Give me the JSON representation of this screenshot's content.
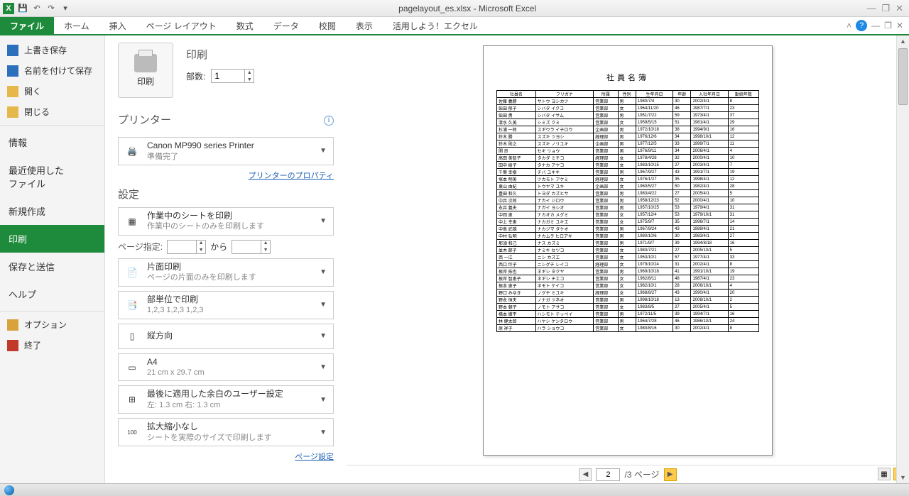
{
  "titlebar": {
    "title": "pagelayout_es.xlsx - Microsoft Excel"
  },
  "ribbon": {
    "file": "ファイル",
    "tabs": [
      "ホーム",
      "挿入",
      "ページ レイアウト",
      "数式",
      "データ",
      "校閲",
      "表示",
      "活用しよう！エクセル"
    ]
  },
  "nav": {
    "save": "上書き保存",
    "saveas": "名前を付けて保存",
    "open": "開く",
    "close": "閉じる",
    "info": "情報",
    "recent1": "最近使用した",
    "recent2": "ファイル",
    "new": "新規作成",
    "print": "印刷",
    "share": "保存と送信",
    "help": "ヘルプ",
    "options": "オプション",
    "exit": "終了"
  },
  "print": {
    "heading": "印刷",
    "button": "印刷",
    "copies_label": "部数:",
    "copies_value": "1"
  },
  "printer": {
    "heading": "プリンター",
    "name": "Canon MP990 series Printer",
    "status": "準備完了",
    "props_link": "プリンターのプロパティ"
  },
  "settings": {
    "heading": "設定",
    "sheet_main": "作業中のシートを印刷",
    "sheet_sub": "作業中のシートのみを印刷します",
    "pages_label": "ページ指定:",
    "pages_sep": "から",
    "duplex_main": "片面印刷",
    "duplex_sub": "ページの片面のみを印刷します",
    "collate_main": "部単位で印刷",
    "collate_sub": "1,2,3   1,2,3   1,2,3",
    "orient": "縦方向",
    "paper_main": "A4",
    "paper_sub": "21 cm x 29.7 cm",
    "margin_main": "最後に適用した余白のユーザー設定",
    "margin_sub": "左: 1.3 cm   右: 1.3 cm",
    "scale_main": "拡大縮小なし",
    "scale_sub": "シートを実際のサイズで印刷します",
    "pagesetup_link": "ページ設定"
  },
  "pager": {
    "current": "2",
    "total": "/3 ページ"
  },
  "doc": {
    "title": "社員名簿",
    "headers": [
      "社員名",
      "フリガナ",
      "所属",
      "性別",
      "生年月日",
      "年齢",
      "入社年月日",
      "勤続年数"
    ],
    "rows": [
      [
        "佐藤 義勝",
        "サトウ ヨシカツ",
        "営業部",
        "男",
        "1980/7/4",
        "30",
        "2002/4/1",
        "8"
      ],
      [
        "柴田 郁子",
        "シバタ イクコ",
        "営業部",
        "女",
        "1964/11/20",
        "46",
        "1987/7/1",
        "23"
      ],
      [
        "柴田 勇",
        "シバタ イサム",
        "営業部",
        "男",
        "1951/7/22",
        "59",
        "1973/4/1",
        "37"
      ],
      [
        "清水 久美",
        "シミズ クミ",
        "営業部",
        "女",
        "1959/5/15",
        "51",
        "1981/4/1",
        "29"
      ],
      [
        "杉浦 一郎",
        "スギウラ イチロウ",
        "企画部",
        "男",
        "1972/10/18",
        "38",
        "1994/9/1",
        "16"
      ],
      [
        "鈴木 勝",
        "スズキ ツヨシ",
        "経理部",
        "男",
        "1976/12/6",
        "34",
        "1998/10/1",
        "12"
      ],
      [
        "鈴木 則之",
        "スズキ ノリユキ",
        "企画部",
        "男",
        "1977/12/5",
        "33",
        "1999/7/1",
        "11"
      ],
      [
        "関 良",
        "セキ リョウ",
        "営業部",
        "男",
        "1976/9/11",
        "34",
        "2006/4/1",
        "4"
      ],
      [
        "高田 美智子",
        "タカダ ミチコ",
        "経理部",
        "女",
        "1978/4/28",
        "32",
        "2000/4/1",
        "10"
      ],
      [
        "田中 綾子",
        "タナカ アヤコ",
        "営業部",
        "女",
        "1983/10/15",
        "27",
        "2003/4/1",
        "7"
      ],
      [
        "千葉 幸樹",
        "チバ ユキキ",
        "営業部",
        "男",
        "1967/9/27",
        "43",
        "1991/7/1",
        "19"
      ],
      [
        "塚本 明美",
        "ツカモト アケミ",
        "経理部",
        "女",
        "1976/1/27",
        "35",
        "1998/4/1",
        "12"
      ],
      [
        "東山 由紀",
        "トウヤマ ユキ",
        "企画部",
        "女",
        "1960/5/27",
        "50",
        "1982/4/1",
        "28"
      ],
      [
        "豊田 和久",
        "トヨダ カズヒサ",
        "営業部",
        "男",
        "1983/4/22",
        "27",
        "2005/4/1",
        "5"
      ],
      [
        "中井 次郎",
        "ナカイ ジロウ",
        "営業部",
        "男",
        "1958/12/23",
        "52",
        "2000/4/1",
        "10"
      ],
      [
        "永井 義夫",
        "ナガイ ヨシオ",
        "営業部",
        "男",
        "1957/10/25",
        "53",
        "1979/4/1",
        "31"
      ],
      [
        "中岡 恵",
        "ナカオカ メグミ",
        "営業部",
        "女",
        "1957/12/4",
        "53",
        "1979/10/1",
        "31"
      ],
      [
        "中上 幸恵",
        "ナカガミ ユキエ",
        "営業部",
        "女",
        "1975/9/7",
        "35",
        "1996/7/1",
        "14"
      ],
      [
        "中島 武雄",
        "ナカジマ タケオ",
        "営業部",
        "男",
        "1967/9/24",
        "43",
        "1989/4/1",
        "21"
      ],
      [
        "中村 弘明",
        "ナカムラ ヒロアキ",
        "営業部",
        "男",
        "1980/10/6",
        "30",
        "1983/4/1",
        "27"
      ],
      [
        "那須 和己",
        "ナス カズミ",
        "営業部",
        "男",
        "1971/9/7",
        "39",
        "1994/8/18",
        "16"
      ],
      [
        "並木 節子",
        "ナミキ セツコ",
        "営業部",
        "女",
        "1983/7/21",
        "27",
        "2005/10/1",
        "5"
      ],
      [
        "西 一江",
        "ニシ カズエ",
        "営業部",
        "女",
        "1953/10/1",
        "57",
        "1977/4/1",
        "33"
      ],
      [
        "西口 玲子",
        "ニシグチ レイコ",
        "経理部",
        "女",
        "1979/10/24",
        "31",
        "2002/4/1",
        "8"
      ],
      [
        "根岸 拓也",
        "ネギシ タクヤ",
        "営業部",
        "男",
        "1969/10/18",
        "41",
        "1991/10/1",
        "19"
      ],
      [
        "根岸 智恵子",
        "ネギシ チエコ",
        "営業部",
        "女",
        "1962/8/11",
        "48",
        "1987/4/1",
        "23"
      ],
      [
        "根本 恵子",
        "ネモト ケイコ",
        "営業部",
        "女",
        "1982/10/1",
        "28",
        "2006/10/1",
        "4"
      ],
      [
        "野口 みゆき",
        "ノグチ ミユキ",
        "経理部",
        "女",
        "1968/8/27",
        "43",
        "1990/4/1",
        "20"
      ],
      [
        "野永 恒夫",
        "ノナガ ツネオ",
        "営業部",
        "男",
        "1998/10/18",
        "13",
        "2008/10/1",
        "2"
      ],
      [
        "野本 朝子",
        "ノモト アサコ",
        "営業部",
        "女",
        "1983/8/5",
        "27",
        "2005/4/1",
        "5"
      ],
      [
        "橋本 徹平",
        "ハシモト テッペイ",
        "営業部",
        "男",
        "1972/11/5",
        "39",
        "1994/7/1",
        "16"
      ],
      [
        "林 健太郎",
        "ハヤシ ケンタロウ",
        "営業部",
        "男",
        "1964/7/28",
        "46",
        "1986/10/1",
        "24"
      ],
      [
        "原 祥子",
        "ハラ ショウコ",
        "営業部",
        "女",
        "1980/8/16",
        "30",
        "2002/4/1",
        "8"
      ]
    ]
  }
}
